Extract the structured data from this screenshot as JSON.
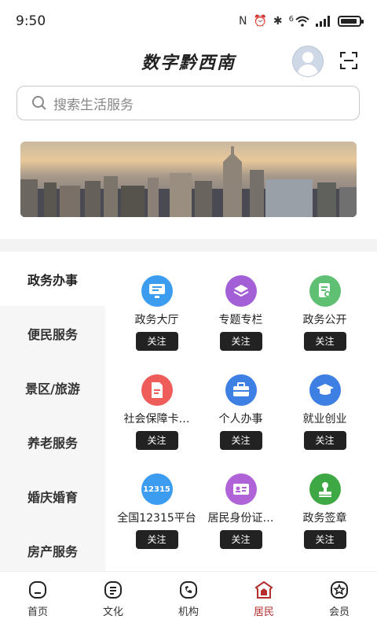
{
  "status": {
    "time": "9:50",
    "network": "6"
  },
  "header": {
    "title": "数字黔西南"
  },
  "search": {
    "placeholder": "搜索生活服务"
  },
  "side_nav": [
    {
      "label": "政务办事",
      "active": true
    },
    {
      "label": "便民服务",
      "active": false
    },
    {
      "label": "景区/旅游",
      "active": false
    },
    {
      "label": "养老服务",
      "active": false
    },
    {
      "label": "婚庆婚育",
      "active": false
    },
    {
      "label": "房产服务",
      "active": false
    }
  ],
  "services": [
    {
      "label": "政务大厅",
      "icon": "monitor-icon",
      "color": "#3b9cf0",
      "button": "关注"
    },
    {
      "label": "专题专栏",
      "icon": "layers-icon",
      "color": "#a35fd6",
      "button": "关注"
    },
    {
      "label": "政务公开",
      "icon": "document-search-icon",
      "color": "#5fbf72",
      "button": "关注"
    },
    {
      "label": "社会保障卡…",
      "icon": "file-icon",
      "color": "#ef5d5a",
      "button": "关注"
    },
    {
      "label": "个人办事",
      "icon": "briefcase-icon",
      "color": "#3d7fe3",
      "button": "关注"
    },
    {
      "label": "就业创业",
      "icon": "graduation-cap-icon",
      "color": "#3d7fe3",
      "button": "关注"
    },
    {
      "label": "全国12315平台",
      "icon": "badge-12315-icon",
      "icon_text": "12315",
      "color": "#3b9cf0",
      "button": "关注"
    },
    {
      "label": "居民身份证…",
      "icon": "id-card-icon",
      "color": "#b063d6",
      "button": "关注"
    },
    {
      "label": "政务签章",
      "icon": "stamp-icon",
      "color": "#3ea845",
      "button": "关注"
    }
  ],
  "tabs": [
    {
      "label": "首页",
      "icon": "home-icon",
      "active": false
    },
    {
      "label": "文化",
      "icon": "culture-icon",
      "active": false
    },
    {
      "label": "机构",
      "icon": "institution-icon",
      "active": false
    },
    {
      "label": "居民",
      "icon": "resident-icon",
      "active": true
    },
    {
      "label": "会员",
      "icon": "member-icon",
      "active": false
    }
  ],
  "colors": {
    "accent": "#b32d2d",
    "button_bg": "#222222"
  }
}
